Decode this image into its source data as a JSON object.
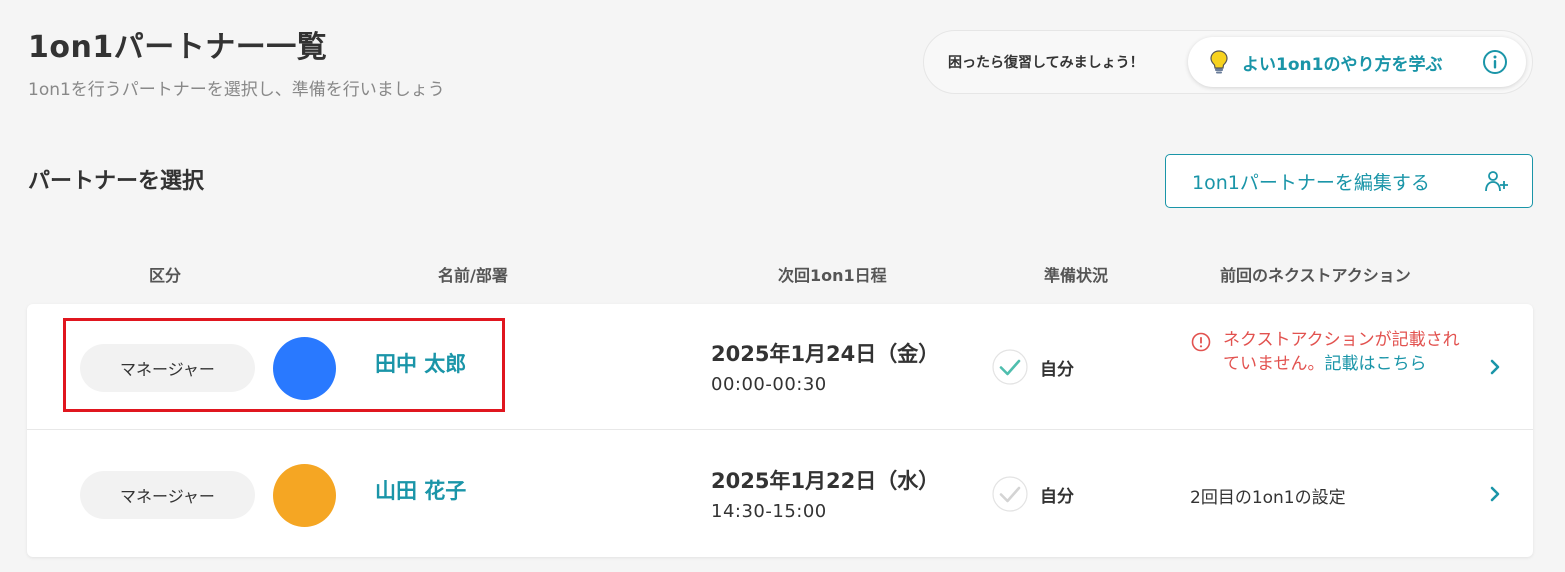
{
  "header": {
    "title": "1on1パートナー一覧",
    "subtitle": "1on1を行うパートナーを選択し、準備を行いましょう"
  },
  "help": {
    "prompt": "困ったら復習してみましょう！",
    "link_label": "よい1on1のやり方を学ぶ"
  },
  "section": {
    "title": "パートナーを選択",
    "edit_button_label": "1on1パートナーを編集する"
  },
  "columns": {
    "category": "区分",
    "name": "名前/部署",
    "schedule": "次回1on1日程",
    "preparation": "準備状況",
    "next_action": "前回のネクストアクション"
  },
  "partners": [
    {
      "role": "マネージャー",
      "name": "田中 太郎",
      "avatar_color": "#2979ff",
      "date": "2025年1月24日（金）",
      "time": "00:00-00:30",
      "prep_status": "自分",
      "prep_done": true,
      "next_action_warning": "ネクストアクションが記載されていません。",
      "next_action_link": "記載はこちら"
    },
    {
      "role": "マネージャー",
      "name": "山田 花子",
      "avatar_color": "#f5a623",
      "date": "2025年1月22日（水）",
      "time": "14:30-15:00",
      "prep_status": "自分",
      "prep_done": false,
      "next_action": "2回目の1on1の設定"
    }
  ],
  "colors": {
    "accent": "#1a95a8",
    "warning": "#e2524f",
    "highlight": "#e0161f",
    "background": "#f5f5f5"
  },
  "icons": {
    "help_bulb": "lightbulb-icon",
    "help_info": "info-icon",
    "edit": "add-user-icon",
    "prep": "check-icon",
    "warning": "warning-icon",
    "row_open": "chevron-right-icon"
  }
}
